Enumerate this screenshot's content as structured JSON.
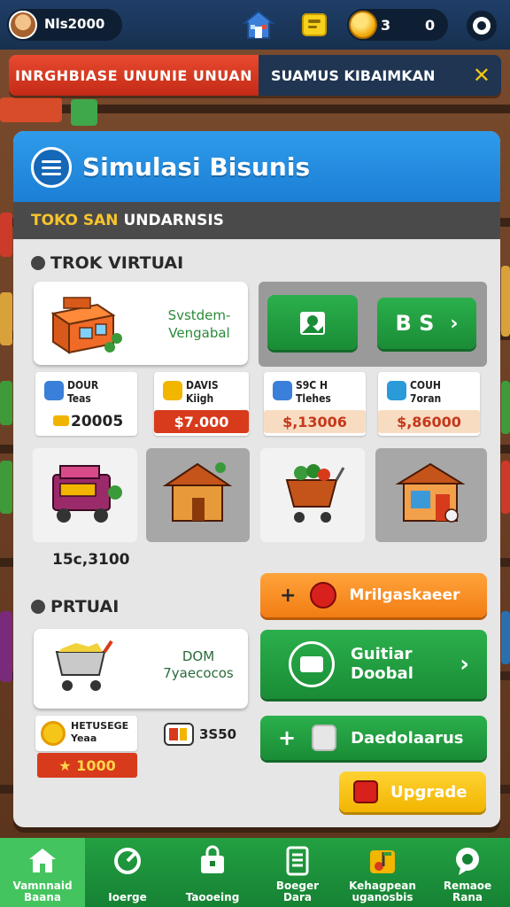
{
  "topbar": {
    "player_name": "Nls2000",
    "coins": "3",
    "gems": "0"
  },
  "banner": {
    "left_text": "INRGHBIASE UNUNIE UNUAN",
    "right_text": "SUAMUS KIBAIMKAN",
    "close_symbol": "✕"
  },
  "panel": {
    "title": "Simulasi Bisunis",
    "subheader_a": "TOKO SAN",
    "subheader_b": "UNDARNSIS"
  },
  "section1": {
    "label": "TROK VIRTUAI",
    "store_card_text": "Svstdem-\nVengabal",
    "green_btn_text": "B S",
    "small_cards": [
      {
        "label": "DOUR\nTeas",
        "price": "20005",
        "price_style": "plain"
      },
      {
        "label": "DAVIS\nKiigh",
        "price": "$7.000",
        "price_style": "red"
      },
      {
        "label": "S9C H\nTlehes",
        "price": "$,13006",
        "price_style": "peach"
      },
      {
        "label": "COUH\n7oran",
        "price": "$,86000",
        "price_style": "peach"
      }
    ],
    "tile_value": "15c,3100"
  },
  "section2": {
    "label": "PRTUAI",
    "cart_card_text": "DOM\n7yaecocos",
    "orange_btn_text": "Mrilgaskaeer",
    "green_btn1_text": "Guitiar\nDoobal",
    "green_btn2_text": "Daedolaarus",
    "yellow_btn_text": "Upgrade",
    "small_card_label": "HETUSEGE\nYeaa",
    "small_card_price": "★ 1000",
    "small_card2_value": "3S50"
  },
  "nav": {
    "items": [
      {
        "label": "Vamnnaid\nBaana",
        "icon": "home-icon",
        "active": true
      },
      {
        "label": "Ioerge",
        "icon": "refresh-icon",
        "active": false
      },
      {
        "label": "Taooeing",
        "icon": "bag-icon",
        "active": false
      },
      {
        "label": "Boeger\nDara",
        "icon": "document-icon",
        "active": false
      },
      {
        "label": "Kehagpean\nuganosbis",
        "icon": "music-icon",
        "active": false
      },
      {
        "label": "Remaoe\nRana",
        "icon": "chat-icon",
        "active": false
      }
    ]
  },
  "colors": {
    "panel_blue": "#2f9bea",
    "green": "#23a042",
    "orange": "#f27d14",
    "yellow": "#f2b500",
    "red": "#d83a1c"
  }
}
